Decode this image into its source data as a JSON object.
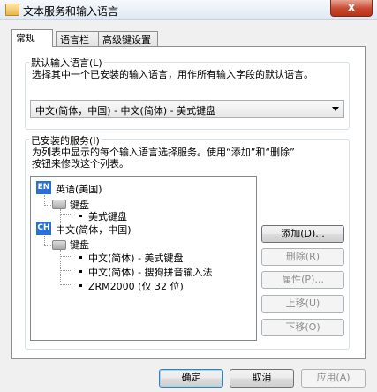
{
  "window": {
    "title": "文本服务和输入语言",
    "close_label": "X"
  },
  "tabs": [
    {
      "label": "常规",
      "active": true
    },
    {
      "label": "语言栏",
      "active": false
    },
    {
      "label": "高级键设置",
      "active": false
    }
  ],
  "default_language": {
    "group_label": "默认输入语言(L)",
    "description": "选择其中一个已安装的输入语言，用作所有输入字段的默认语言。",
    "selected": "中文(简体，中国) - 中文(简体) - 美式键盘"
  },
  "installed_services": {
    "group_label": "已安装的服务(I)",
    "description_line1": "为列表中显示的每个输入语言选择服务。使用“添加”和“删除”",
    "description_line2": "按钮来修改这个列表。",
    "tree": {
      "en_badge": "EN",
      "en_language": "英语(美国)",
      "en_keyboard_group": "键盘",
      "en_keyboard_item": "美式键盘",
      "ch_badge": "CH",
      "ch_language": "中文(简体，中国)",
      "ch_keyboard_group": "键盘",
      "ch_item1": "中文(简体) - 美式键盘",
      "ch_item2": "中文(简体) - 搜狗拼音输入法",
      "ch_item3": "ZRM2000 (仅 32 位)"
    },
    "buttons": {
      "add": "添加(D)...",
      "remove": "删除(R)",
      "properties": "属性(P)...",
      "move_up": "上移(U)",
      "move_down": "下移(O)"
    }
  },
  "footer": {
    "ok": "确定",
    "cancel": "取消",
    "apply": "应用(A)"
  }
}
